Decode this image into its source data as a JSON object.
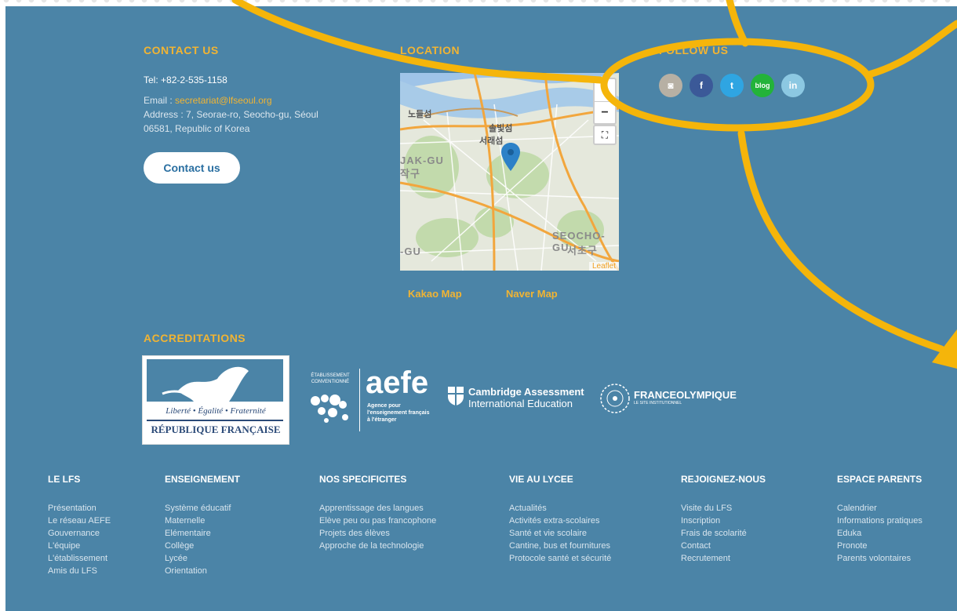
{
  "contact": {
    "heading": "CONTACT US",
    "tel": "Tel: +82-2-535-1158",
    "email_label": "Email : ",
    "email": "secretariat@lfseoul.org",
    "address_line1": "Address : 7, Seorae-ro, Seocho-gu, Séoul",
    "address_line2": "06581, Republic of Korea",
    "button": "Contact us"
  },
  "location": {
    "heading": "LOCATION",
    "zoom_in": "+",
    "zoom_out": "−",
    "fullscreen": "⛶",
    "attribution": "Leaflet",
    "labels": {
      "l1": "노들섬",
      "l2": "솔빛섬",
      "l3": "서래섬",
      "l4": "JAK-GU",
      "l5": "작구",
      "l6": "SEOCHO-GU",
      "l7": "서초구",
      "l8": "-GU"
    },
    "links": [
      "Kakao Map",
      "Naver Map"
    ]
  },
  "follow": {
    "heading": "FOLLOW US",
    "icons": [
      {
        "name": "instagram",
        "glyph": "◙",
        "color": "#b7b0a4"
      },
      {
        "name": "facebook",
        "glyph": "f",
        "color": "#3b5998"
      },
      {
        "name": "twitter",
        "glyph": "t",
        "color": "#2fa5e2"
      },
      {
        "name": "blog",
        "glyph": "blog",
        "color": "#23b33a"
      },
      {
        "name": "linkedin",
        "glyph": "in",
        "color": "#8cc8e2"
      }
    ]
  },
  "accreditations": {
    "heading": "ACCREDITATIONS",
    "republique_motto": "Liberté • Égalité • Fraternité",
    "republique_name": "RÉPUBLIQUE FRANÇAISE",
    "aefe_small1": "ÉTABLISSEMENT",
    "aefe_small2": "CONVENTIONNÉ",
    "aefe_logo": "aefe",
    "aefe_sub1": "Agence pour",
    "aefe_sub2": "l'enseignement français",
    "aefe_sub3": "à l'étranger",
    "cambridge1": "Cambridge Assessment",
    "cambridge2": "International Education",
    "franceolympique": "FRANCEOLYMPIQUE",
    "franceolympique_sub": "LE SITE INSTITUTIONNEL"
  },
  "footer_columns": [
    {
      "title": "LE LFS",
      "items": [
        "Présentation",
        "Le réseau AEFE",
        "Gouvernance",
        "L'équipe",
        "L'établissement",
        "Amis du LFS"
      ]
    },
    {
      "title": "ENSEIGNEMENT",
      "items": [
        "Système éducatif",
        "Maternelle",
        "Elémentaire",
        "Collège",
        "Lycée",
        "Orientation"
      ]
    },
    {
      "title": "NOS SPECIFICITES",
      "items": [
        "Apprentissage des langues",
        "Elève peu ou pas francophone",
        "Projets des élèves",
        "Approche de la technologie"
      ]
    },
    {
      "title": "VIE AU LYCEE",
      "items": [
        "Actualités",
        "Activités extra-scolaires",
        "Santé et vie scolaire",
        "Cantine, bus et fournitures",
        "Protocole santé et sécurité"
      ]
    },
    {
      "title": "REJOIGNEZ-NOUS",
      "items": [
        "Visite du LFS",
        "Inscription",
        "Frais de scolarité",
        "Contact",
        "Recrutement"
      ]
    },
    {
      "title": "ESPACE PARENTS",
      "items": [
        "Calendrier",
        "Informations pratiques",
        "Eduka",
        "Pronote",
        "Parents volontaires"
      ]
    }
  ],
  "colors": {
    "background": "#4b84a7",
    "accent": "#f1b433",
    "annotation": "#f5b50a"
  }
}
